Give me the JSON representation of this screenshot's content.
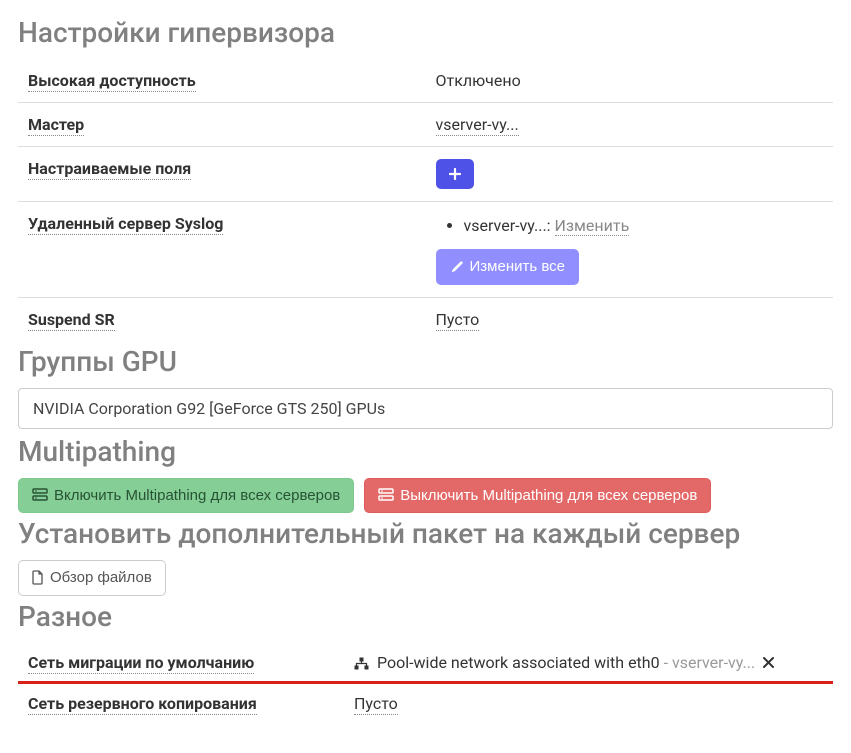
{
  "hypervisor": {
    "title": "Настройки гипервизора",
    "rows": {
      "ha_label": "Высокая доступность",
      "ha_value": "Отключено",
      "master_label": "Мастер",
      "master_value": "vserver-vy...",
      "custom_fields_label": "Настраиваемые поля",
      "syslog_label": "Удаленный сервер Syslog",
      "syslog_items": {
        "item0_server": "vserver-vy...",
        "item0_sep": ": ",
        "item0_action": "Изменить"
      },
      "edit_all_label": "Изменить все",
      "suspend_label": "Suspend SR",
      "suspend_value": "Пусто"
    }
  },
  "gpu": {
    "title": "Группы GPU",
    "item0": "NVIDIA Corporation G92 [GeForce GTS 250] GPUs"
  },
  "multipathing": {
    "title": "Multipathing",
    "enable_label": "Включить Multipathing для всех серверов",
    "disable_label": "Выключить Multipathing для всех серверов"
  },
  "install_pack": {
    "title": "Установить дополнительный пакет на каждый сервер",
    "browse_label": "Обзор файлов"
  },
  "misc": {
    "title": "Разное",
    "migration_net_label": "Сеть миграции по умолчанию",
    "migration_net_value": "Pool-wide network associated with eth0",
    "migration_net_suffix": " - vserver-vy...",
    "backup_net_label": "Сеть резервного копирования",
    "backup_net_value": "Пусто"
  }
}
